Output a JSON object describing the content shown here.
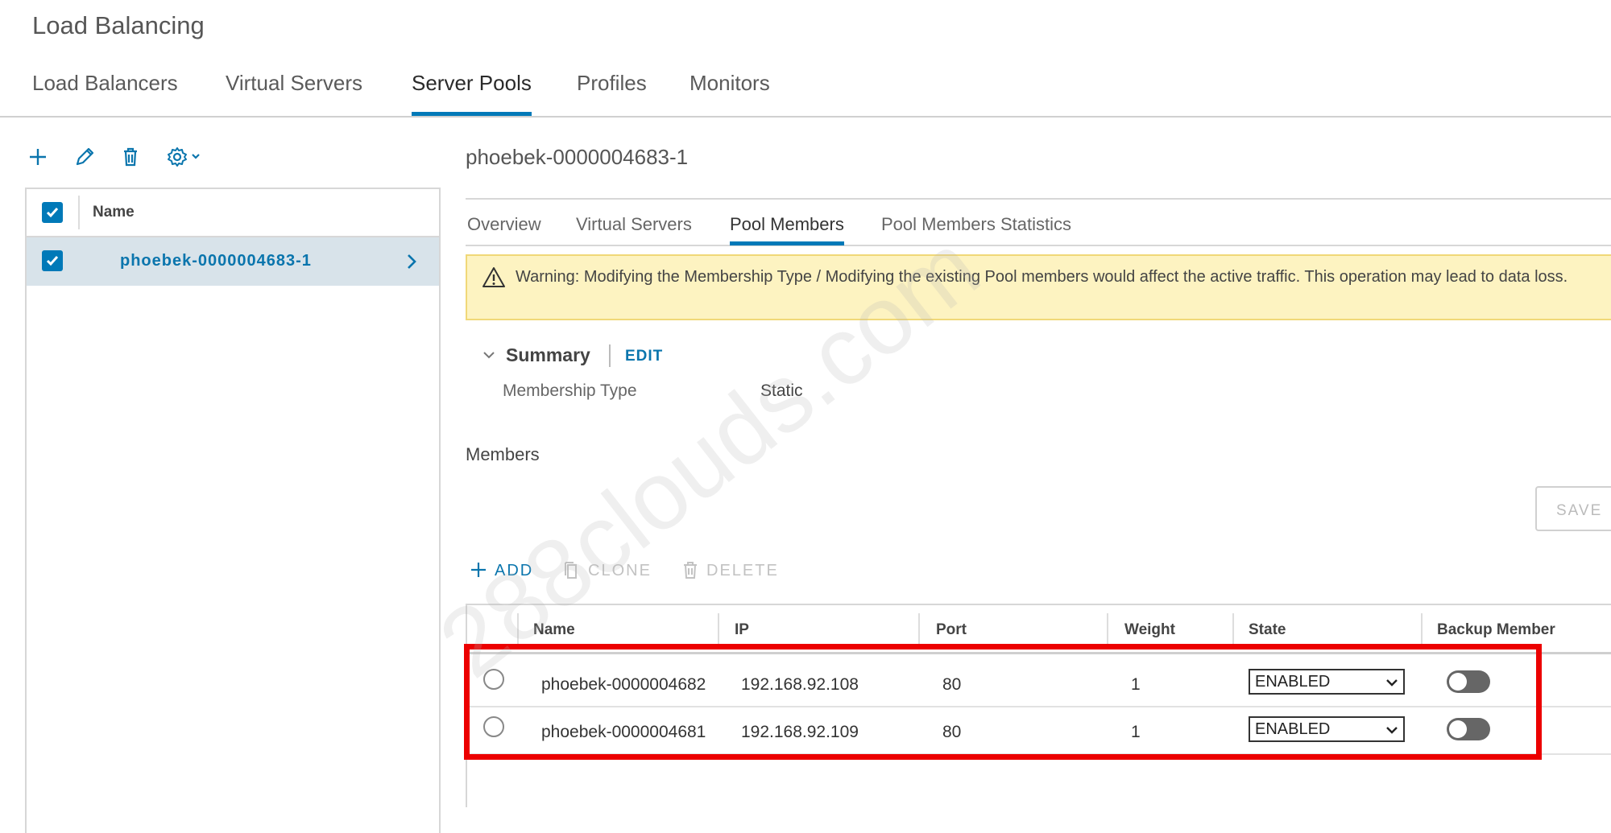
{
  "page_title": "Load Balancing",
  "top_tabs": [
    "Load Balancers",
    "Virtual Servers",
    "Server Pools",
    "Profiles",
    "Monitors"
  ],
  "active_top_tab": "Server Pools",
  "left_panel": {
    "header": "Name",
    "rows": [
      {
        "name": "phoebek-0000004683-1"
      }
    ]
  },
  "detail": {
    "title": "phoebek-0000004683-1",
    "tabs": [
      "Overview",
      "Virtual Servers",
      "Pool Members",
      "Pool Members Statistics"
    ],
    "active_tab": "Pool Members",
    "warning": "Warning: Modifying the Membership Type / Modifying the existing Pool members would affect the active traffic. This operation may lead to data loss.",
    "summary": {
      "title": "Summary",
      "edit": "EDIT",
      "membership_type_label": "Membership Type",
      "membership_type_value": "Static"
    },
    "members": {
      "title": "Members",
      "save": "SAVE",
      "actions": {
        "add": "ADD",
        "clone": "CLONE",
        "delete": "DELETE"
      },
      "columns": [
        "Name",
        "IP",
        "Port",
        "Weight",
        "State",
        "Backup Member"
      ],
      "rows": [
        {
          "name": "phoebek-0000004682",
          "ip": "192.168.92.108",
          "port": "80",
          "weight": "1",
          "state": "ENABLED",
          "backup": false
        },
        {
          "name": "phoebek-0000004681",
          "ip": "192.168.92.109",
          "port": "80",
          "weight": "1",
          "state": "ENABLED",
          "backup": false
        }
      ]
    }
  },
  "watermark": "288clouds.com",
  "colors": {
    "accent": "#0079b8",
    "warning_bg": "#fdf3c1",
    "highlight": "#ec0000",
    "selected_row": "#d8e3ea"
  }
}
